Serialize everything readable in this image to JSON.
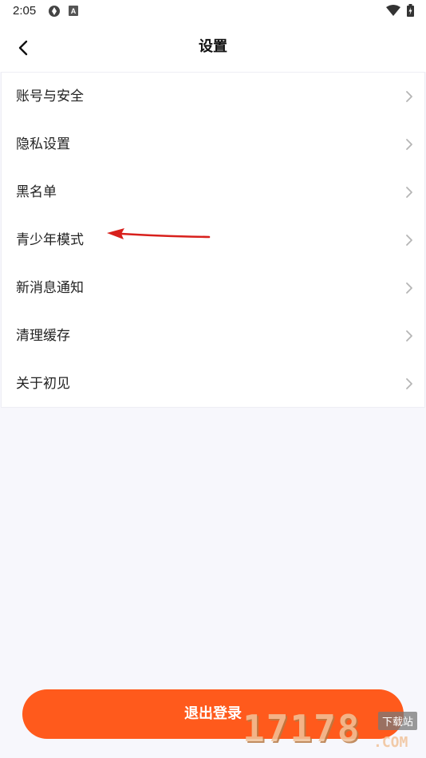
{
  "status_bar": {
    "time": "2:05",
    "icons": [
      "sync-icon",
      "app-a-icon",
      "wifi-icon",
      "battery-charging-icon"
    ]
  },
  "header": {
    "title": "设置",
    "back_icon": "chevron-left-icon"
  },
  "menu": {
    "items": [
      {
        "label": "账号与安全",
        "icon": "chevron-right-icon"
      },
      {
        "label": "隐私设置",
        "icon": "chevron-right-icon"
      },
      {
        "label": "黑名单",
        "icon": "chevron-right-icon"
      },
      {
        "label": "青少年模式",
        "icon": "chevron-right-icon"
      },
      {
        "label": "新消息通知",
        "icon": "chevron-right-icon"
      },
      {
        "label": "清理缓存",
        "icon": "chevron-right-icon"
      },
      {
        "label": "关于初见",
        "icon": "chevron-right-icon"
      }
    ]
  },
  "logout_label": "退出登录",
  "watermark": {
    "number": "17178",
    "badge": "下载站",
    "domain": ".COM"
  },
  "colors": {
    "accent": "#ff5a1c",
    "background": "#f7f7fc",
    "annotation_arrow": "#d8201c"
  }
}
